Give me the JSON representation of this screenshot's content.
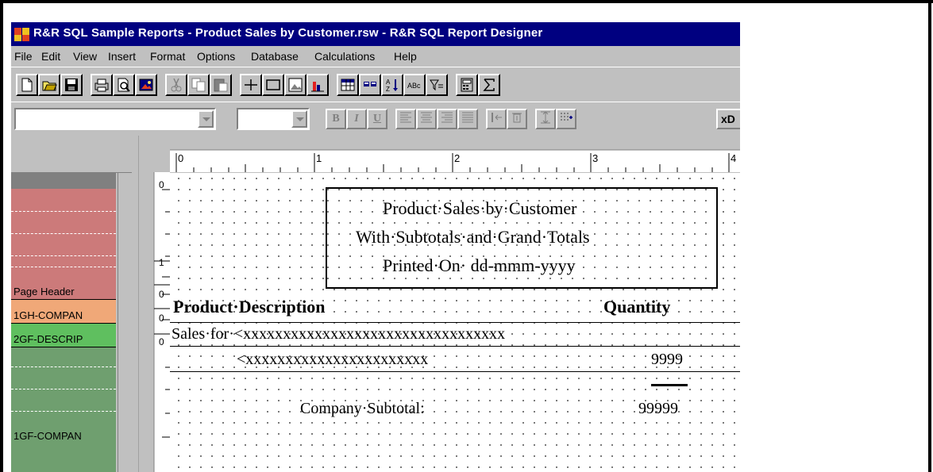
{
  "window": {
    "title": "R&R SQL Sample Reports - Product Sales by Customer.rsw - R&R SQL Report Designer"
  },
  "menu": {
    "items": [
      "File",
      "Edit",
      "View",
      "Insert",
      "Format",
      "Options",
      "Database",
      "Calculations",
      "Help"
    ]
  },
  "toolbar": {
    "buttons": [
      "new-icon",
      "open-icon",
      "save-icon",
      "print-icon",
      "print-preview-icon",
      "picture-icon",
      "cut-icon",
      "copy-icon",
      "paste-icon",
      "line-icon",
      "box-icon",
      "image-field-icon",
      "chart-icon",
      "table-icon",
      "insert-field-icon",
      "sort-icon",
      "text-case-icon",
      "filter-icon",
      "calculator-icon",
      "sum-icon"
    ]
  },
  "format_toolbar": {
    "font_name": "",
    "font_size": "",
    "bold": "B",
    "italic": "I",
    "underline": "U",
    "extra_label": "xD"
  },
  "ruler": {
    "marks": [
      "0",
      "1",
      "2",
      "3",
      "4"
    ],
    "vertical_marks": [
      "0",
      "1",
      "0",
      "0",
      "0"
    ]
  },
  "bands": [
    {
      "label": "",
      "color": "#cc7a7a"
    },
    {
      "label": "Page Header",
      "color": "#cc7a7a"
    },
    {
      "label": "1GH-COMPAN",
      "color": "#f0a878"
    },
    {
      "label": "2GF-DESCRIP",
      "color": "#5fbf5f"
    },
    {
      "label": "1GF-COMPAN",
      "color": "#6f9f6f"
    }
  ],
  "report": {
    "title_lines": [
      "Product·Sales·by·Customer",
      "With·Subtotals·and·Grand·Totals",
      "Printed·On· dd-mmm-yyyy"
    ],
    "col_product": "Product·Description",
    "col_quantity": "Quantity",
    "group_header": "Sales·for·<xxxxxxxxxxxxxxxxxxxxxxxxxxxxxxxxx",
    "detail_field": "<xxxxxxxxxxxxxxxxxxxxxxx",
    "detail_qty": "9999",
    "subtotal_label": "Company·Subtotal:",
    "subtotal_value": "99999"
  }
}
